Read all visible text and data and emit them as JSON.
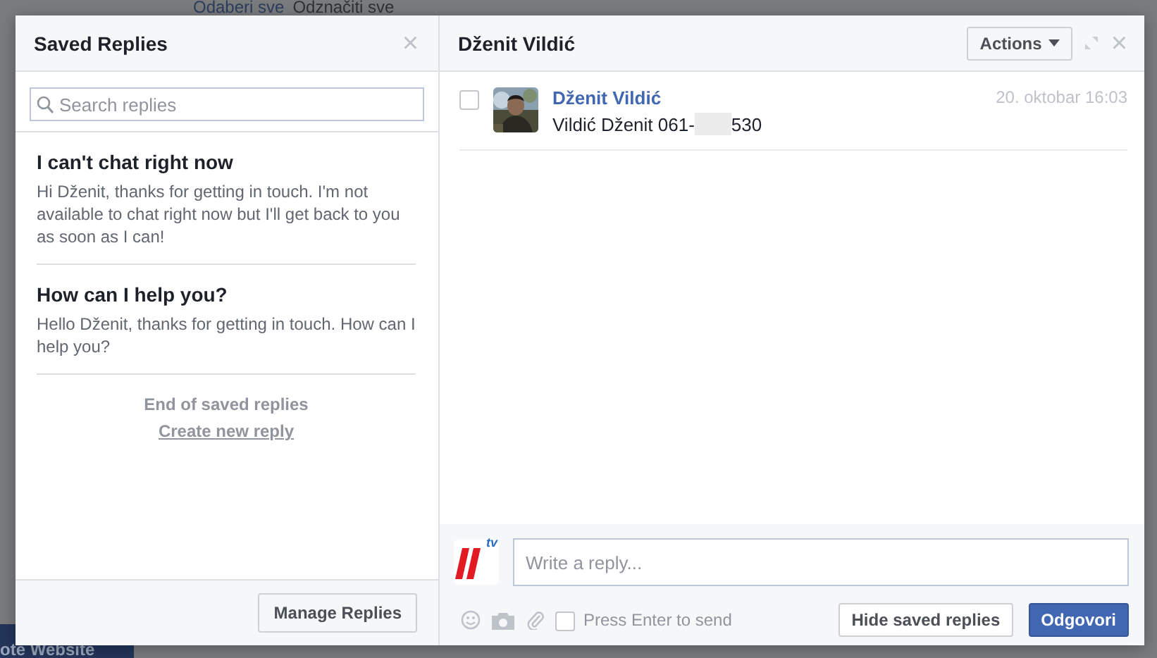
{
  "background": {
    "select_all": "Odaberi sve",
    "deselect_all": "Odznačiti sve",
    "sidebar_button": "ote Website"
  },
  "saved_replies": {
    "title": "Saved Replies",
    "close": "×",
    "search": {
      "placeholder": "Search replies"
    },
    "replies": [
      {
        "title": "I can't chat right now",
        "body": "Hi Dženit, thanks for getting in touch. I'm not available to chat right now but I'll get back to you as soon as I can!"
      },
      {
        "title": "How can I help you?",
        "body": "Hello Dženit, thanks for getting in touch. How can I help you?"
      }
    ],
    "end_text": "End of saved replies",
    "create_link": "Create new reply",
    "manage_button": "Manage Replies"
  },
  "conversation": {
    "title": "Dženit Vildić",
    "actions_button": "Actions",
    "close": "×",
    "messages": [
      {
        "checked": false,
        "sender": "Dženit Vildić",
        "time": "20. oktobar 16:03",
        "text_before": "Vildić Dženit 061-",
        "text_after": "530",
        "redacted": true
      }
    ],
    "composer": {
      "logo_text": "tv",
      "placeholder": "Write a reply...",
      "enter_to_send": {
        "label": "Press Enter to send",
        "checked": false
      },
      "hide_button": "Hide saved replies",
      "send_button": "Odgovori"
    }
  }
}
